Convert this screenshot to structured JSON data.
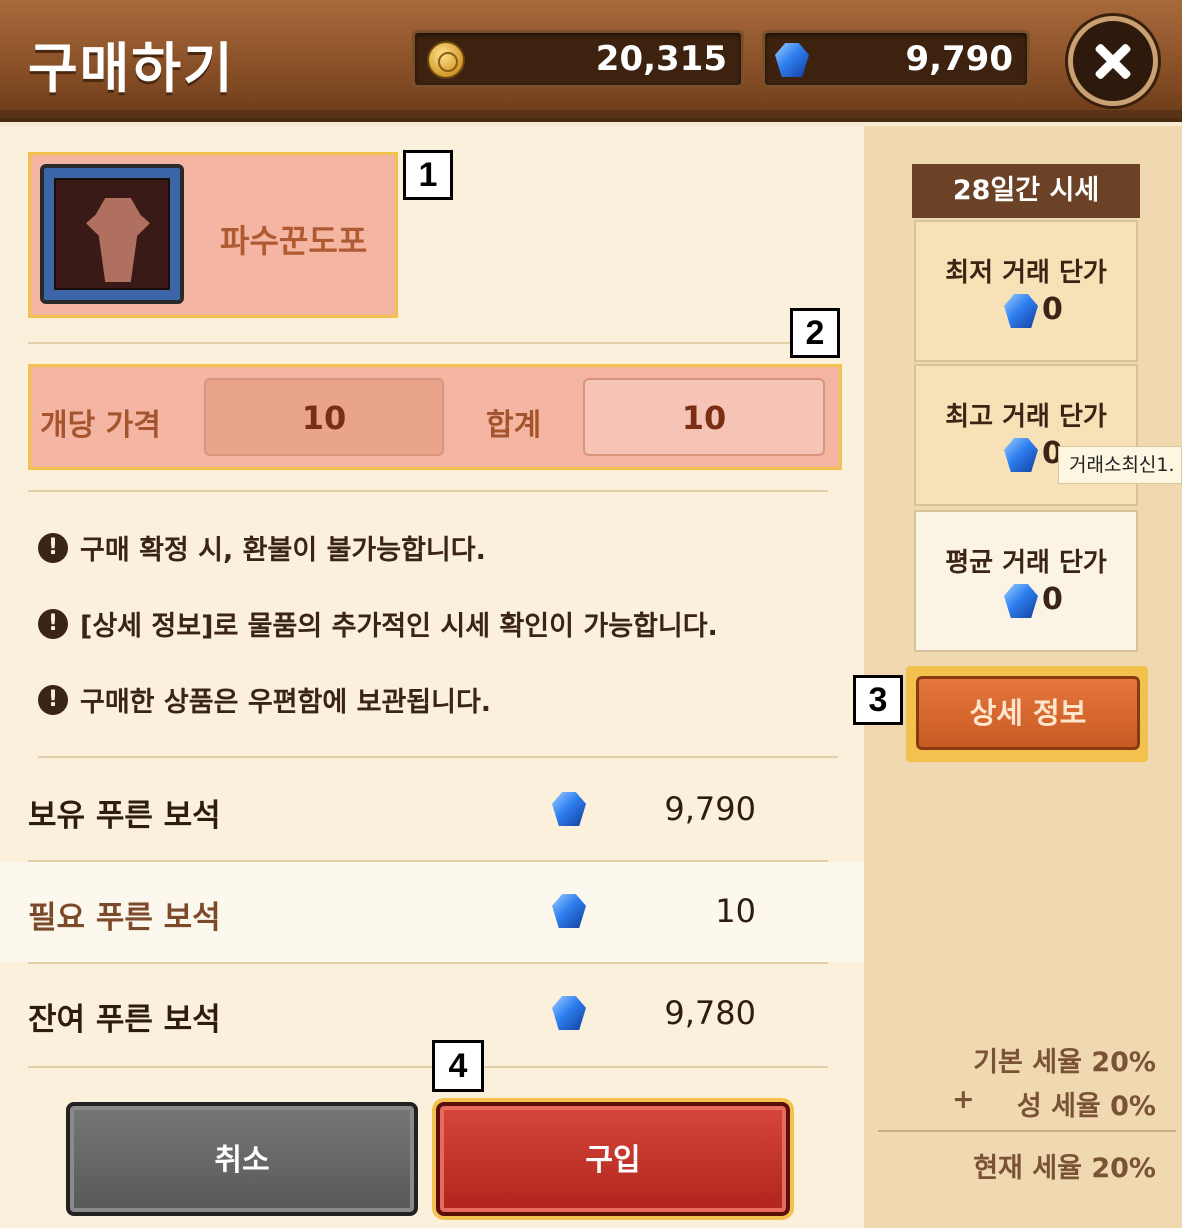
{
  "header": {
    "title": "구매하기",
    "gold": "20,315",
    "gems": "9,790"
  },
  "item": {
    "name": "파수꾼도포"
  },
  "badges": [
    "1",
    "2",
    "3",
    "4"
  ],
  "price": {
    "unit_label": "개당 가격",
    "unit_value": "10",
    "total_label": "합계",
    "total_value": "10"
  },
  "notices": [
    "구매 확정 시, 환불이 불가능합니다.",
    "[상세 정보]로 물품의 추가적인 시세 확인이 가능합니다.",
    "구매한 상품은 우편함에 보관됩니다."
  ],
  "summary": [
    {
      "label": "보유 푸른 보석",
      "value": "9,790"
    },
    {
      "label": "필요 푸른 보석",
      "value": "10"
    },
    {
      "label": "잔여 푸른 보석",
      "value": "9,780"
    }
  ],
  "buttons": {
    "cancel": "취소",
    "buy": "구입"
  },
  "stats": {
    "header": "28일간 시세",
    "items": [
      {
        "label": "최저 거래 단가",
        "value": "0"
      },
      {
        "label": "최고 거래 단가",
        "value": "0"
      },
      {
        "label": "평균 거래 단가",
        "value": "0"
      }
    ],
    "tooltip": "거래소최신1.",
    "detail_button": "상세 정보"
  },
  "tax": {
    "base": "기본 세율 20%",
    "plus": "+",
    "castle": "성 세율 0%",
    "current": "현재 세율 20%"
  },
  "colors": {
    "accent_highlight": "#f2c14e",
    "buy_button": "#c0392b",
    "gem": "#2f7ff0"
  }
}
